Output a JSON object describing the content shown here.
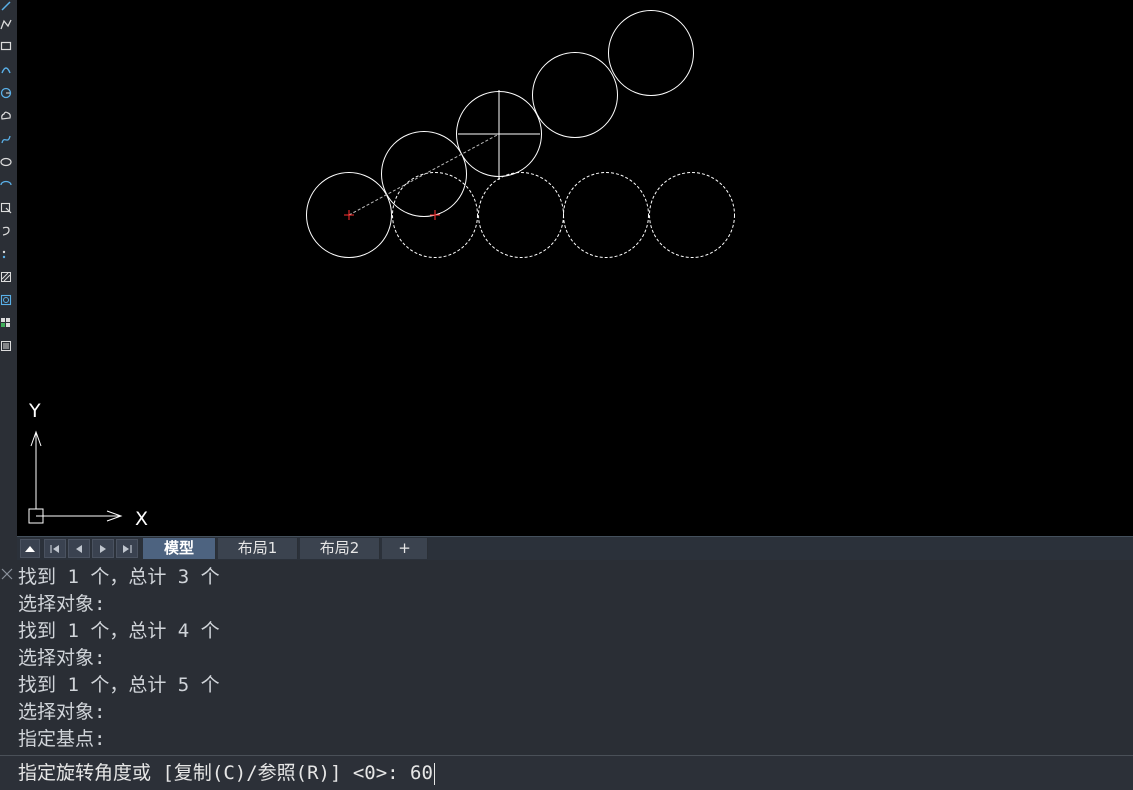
{
  "toolbar": {
    "tools": [
      "line-icon",
      "polyline-icon",
      "rectangle-icon",
      "arc-icon",
      "circle-icon",
      "revcloud-icon",
      "spline-icon",
      "ellipse-icon",
      "ellipse-arc-icon",
      "insert-block-icon",
      "make-block-icon",
      "point-icon",
      "hatch-icon",
      "gradient-icon",
      "table-icon",
      "multiline-text-icon"
    ]
  },
  "canvas": {
    "ucs": {
      "x_label": "X",
      "y_label": "Y"
    },
    "colors": {
      "background": "#000000",
      "geometry": "#ffffff",
      "base_marker": "#ff3030"
    }
  },
  "tabs": {
    "model": "模型",
    "layout1": "布局1",
    "layout2": "布局2",
    "add": "+"
  },
  "command": {
    "history": [
      "找到 1 个，总计 3 个",
      "选择对象:",
      "找到 1 个，总计 4 个",
      "选择对象:",
      "找到 1 个，总计 5 个",
      "选择对象:",
      "指定基点:"
    ],
    "prompt": "指定旋转角度或 [复制(C)/参照(R)] <0>: 60"
  }
}
